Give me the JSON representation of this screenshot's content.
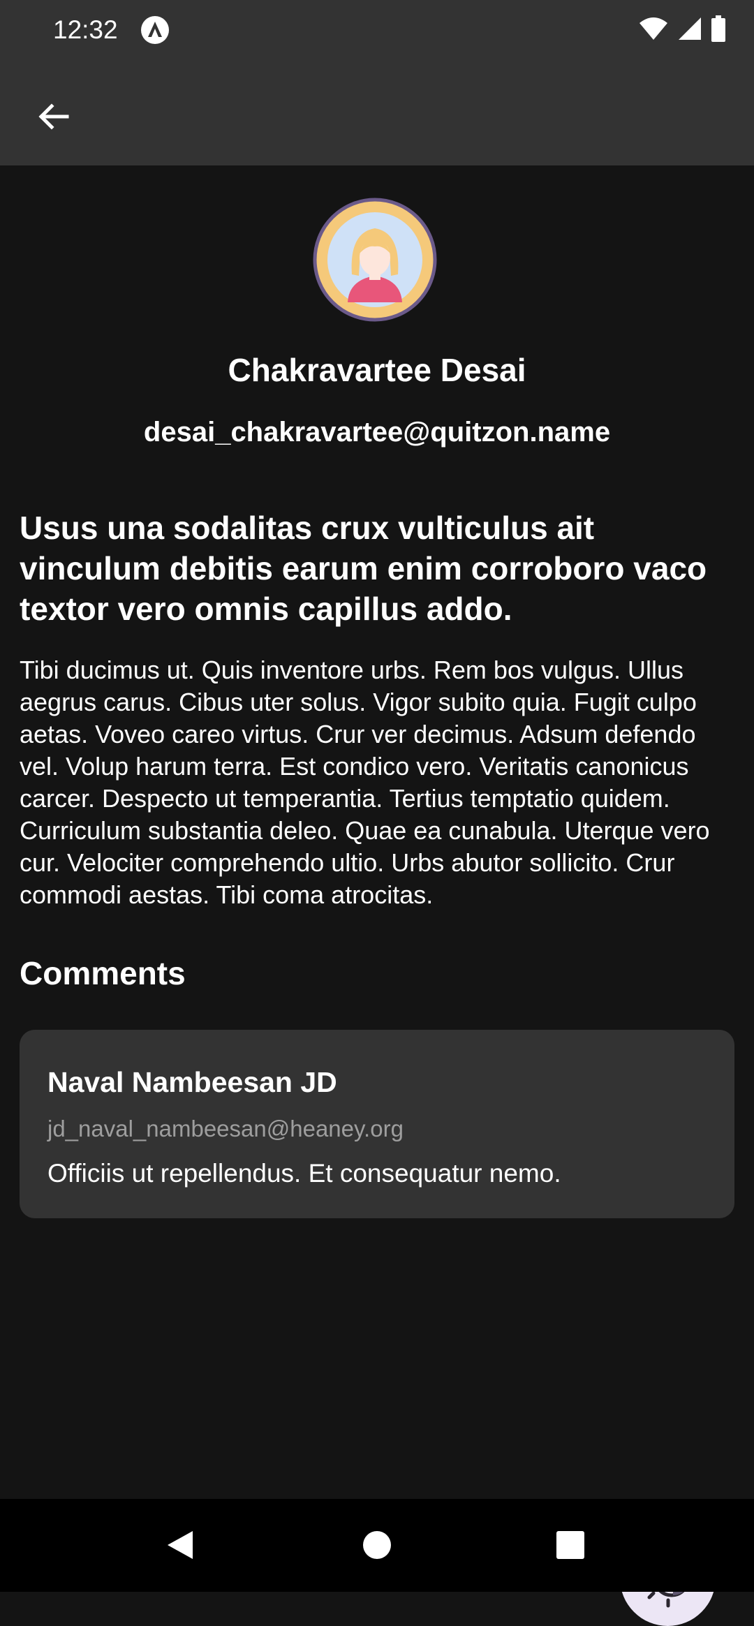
{
  "status_bar": {
    "time": "12:32",
    "icons": [
      "app-notification-icon",
      "wifi-icon",
      "signal-icon",
      "battery-icon"
    ]
  },
  "app_bar": {
    "back_icon": "arrow-left-icon"
  },
  "user": {
    "name": "Chakravartee Desai",
    "email": "desai_chakravartee@quitzon.name",
    "avatar_icon": "woman-avatar-icon"
  },
  "post": {
    "title": "Usus una sodalitas crux vulticulus ait vinculum debitis earum enim corroboro vaco textor vero omnis capillus addo.",
    "body": "Tibi ducimus ut. Quis inventore urbs. Rem bos vulgus. Ullus aegrus carus. Cibus uter solus. Vigor subito quia. Fugit culpo aetas. Voveo careo virtus. Crur ver decimus. Adsum defendo vel. Volup harum terra. Est condico vero. Veritatis canonicus carcer. Despecto ut temperantia. Tertius temptatio quidem. Curriculum substantia deleo. Quae ea cunabula. Uterque vero cur. Velociter comprehendo ultio. Urbs abutor sollicito. Crur commodi aestas. Tibi coma atrocitas."
  },
  "comments": {
    "heading": "Comments",
    "items": [
      {
        "author": "Naval Nambeesan JD",
        "email": "jd_naval_nambeesan@heaney.org",
        "text": "Officiis ut repellendus. Et consequatur nemo."
      }
    ]
  },
  "fab": {
    "icon": "theme-toggle-icon"
  },
  "nav": {
    "icons": [
      "back-triangle-icon",
      "home-circle-icon",
      "recents-square-icon"
    ]
  },
  "colors": {
    "background": "#141414",
    "surface": "#333333",
    "fab_background": "#ece6f5",
    "muted_text": "#9e9e9e"
  }
}
